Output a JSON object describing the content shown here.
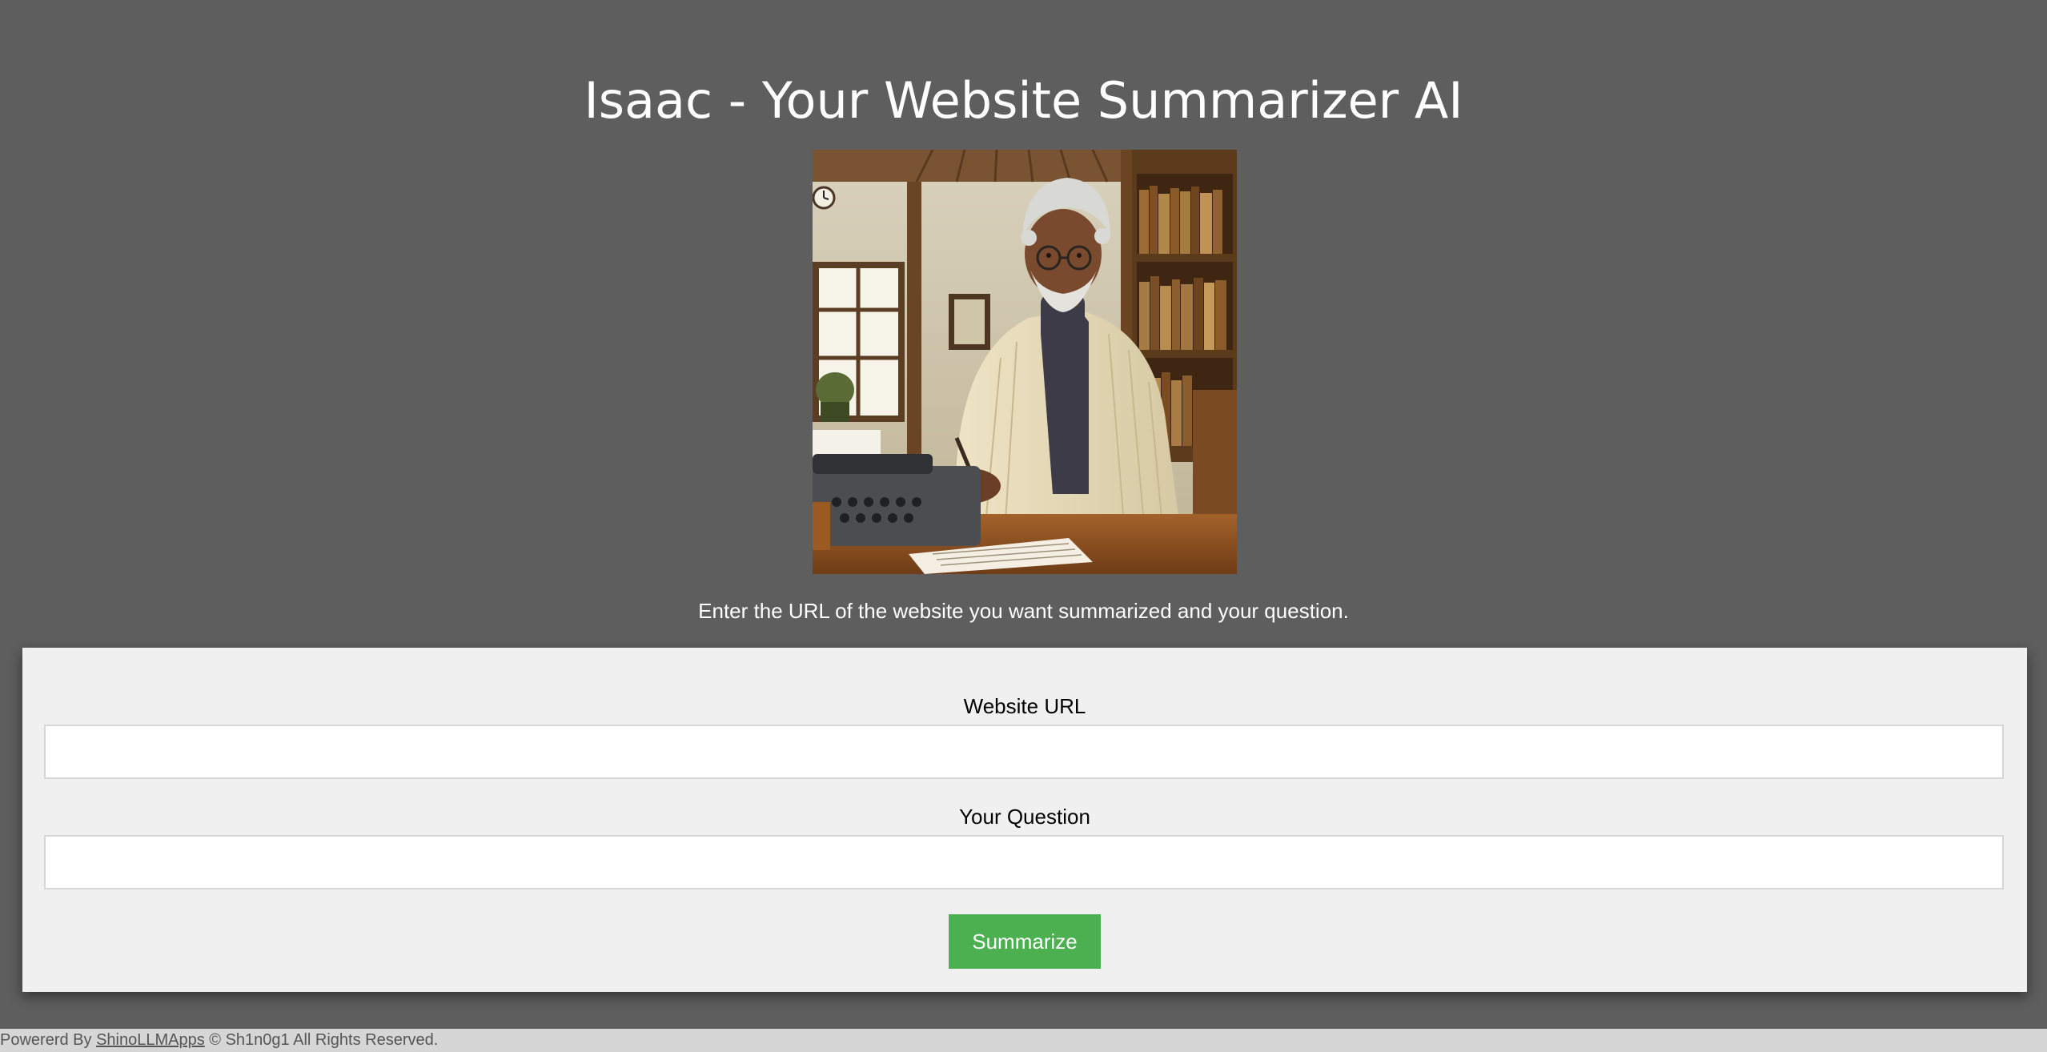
{
  "header": {
    "title": "Isaac - Your Website Summarizer AI"
  },
  "intro": {
    "text": "Enter the URL of the website you want summarized and your question."
  },
  "form": {
    "url_label": "Website URL",
    "url_value": "",
    "question_label": "Your Question",
    "question_value": "",
    "submit_label": "Summarize"
  },
  "footer": {
    "prefix": "Powererd By ",
    "link_text": "ShinoLLMApps",
    "suffix": " © Sh1n0g1 All Rights Reserved."
  },
  "colors": {
    "page_background": "#5e5e5e",
    "card_background": "#f0f0f0",
    "button_green": "#4caf50",
    "footer_background": "#d6d6d6"
  },
  "icons": {
    "portrait": "isaac-portrait-illustration"
  }
}
